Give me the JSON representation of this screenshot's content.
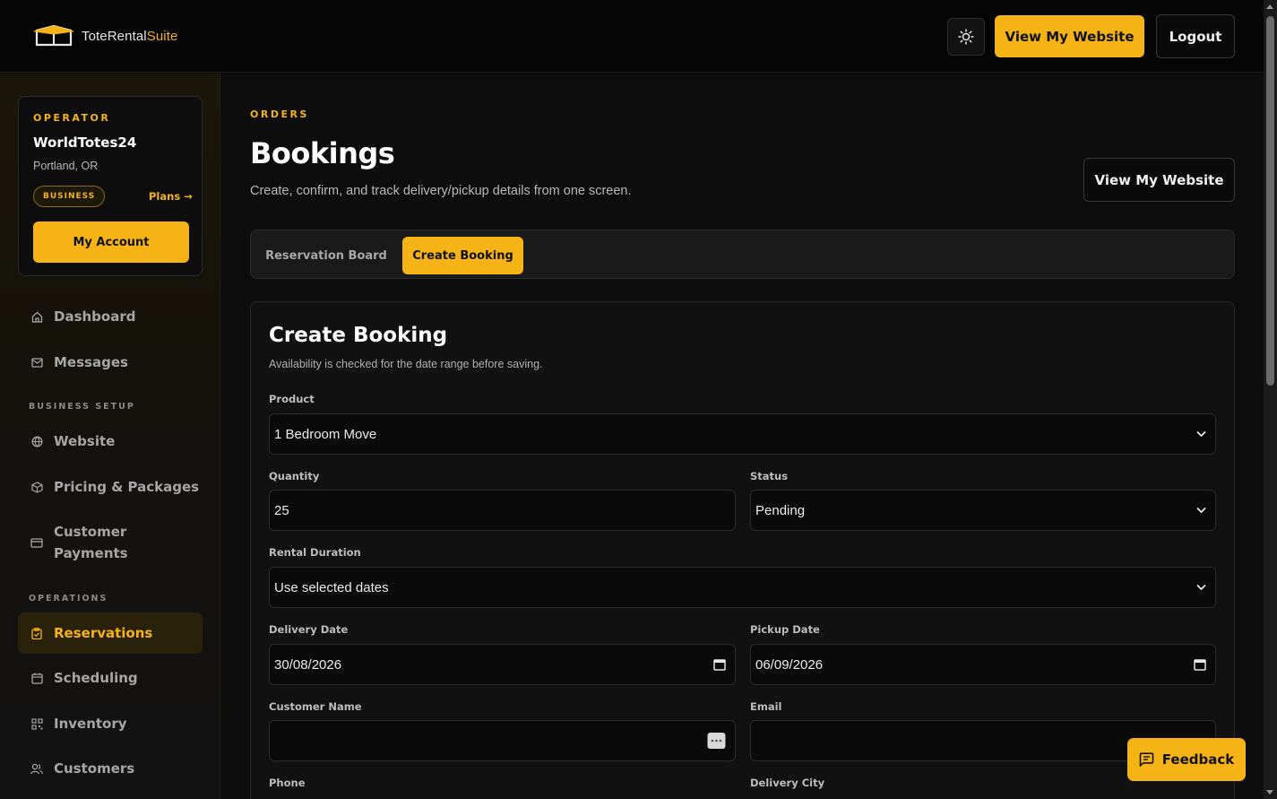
{
  "brand": {
    "name_part1": "ToteRental",
    "name_part2": "Suite"
  },
  "header": {
    "view_website": "View My Website",
    "logout": "Logout",
    "theme_icon": "sun-icon"
  },
  "operator": {
    "kicker": "OPERATOR",
    "name": "WorldTotes24",
    "location": "Portland, OR",
    "plan_badge": "BUSINESS",
    "plans_link": "Plans →",
    "account_button": "My Account"
  },
  "nav": {
    "dashboard": "Dashboard",
    "messages": "Messages",
    "section_business": "BUSINESS SETUP",
    "website": "Website",
    "pricing": "Pricing & Packages",
    "payments": "Customer Payments",
    "section_operations": "OPERATIONS",
    "reservations": "Reservations",
    "scheduling": "Scheduling",
    "inventory": "Inventory",
    "customers": "Customers"
  },
  "page": {
    "kicker": "ORDERS",
    "title": "Bookings",
    "subtitle": "Create, confirm, and track delivery/pickup details from one screen.",
    "view_website": "View My Website"
  },
  "tabs": {
    "board": "Reservation Board",
    "create": "Create Booking"
  },
  "form": {
    "title": "Create Booking",
    "subtitle": "Availability is checked for the date range before saving.",
    "product_label": "Product",
    "product_value": "1 Bedroom Move",
    "quantity_label": "Quantity",
    "quantity_value": "25",
    "status_label": "Status",
    "status_value": "Pending",
    "duration_label": "Rental Duration",
    "duration_value": "Use selected dates",
    "delivery_label": "Delivery Date",
    "delivery_value": "30/08/2026",
    "pickup_label": "Pickup Date",
    "pickup_value": "06/09/2026",
    "customer_label": "Customer Name",
    "customer_value": "",
    "email_label": "Email",
    "email_value": "",
    "phone_label": "Phone",
    "city_label": "Delivery City"
  },
  "feedback": {
    "label": "Feedback"
  },
  "colors": {
    "accent": "#f5b316",
    "background": "#0d0d0d",
    "card": "#111111"
  }
}
